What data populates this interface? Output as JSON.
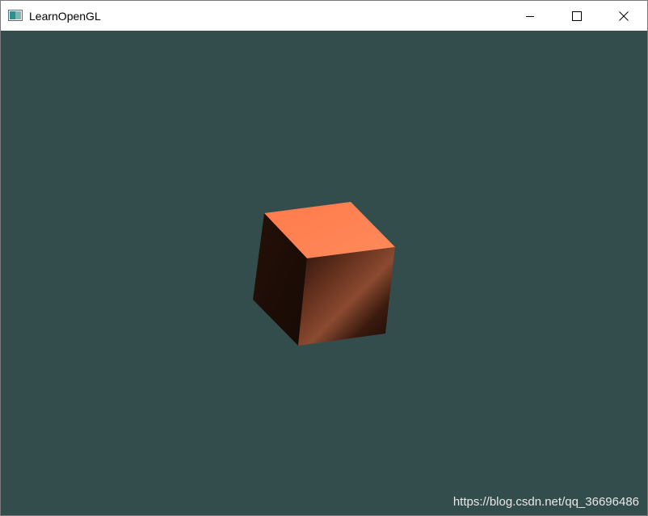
{
  "window": {
    "title": "LearnOpenGL",
    "controls": {
      "minimize": "minimize-icon",
      "maximize": "maximize-icon",
      "close": "close-icon"
    }
  },
  "viewport": {
    "clear_color": "#334d4d",
    "object": "cube",
    "cube_color": "#ff7f50"
  },
  "watermark": {
    "text": "https://blog.csdn.net/qq_36696486"
  }
}
